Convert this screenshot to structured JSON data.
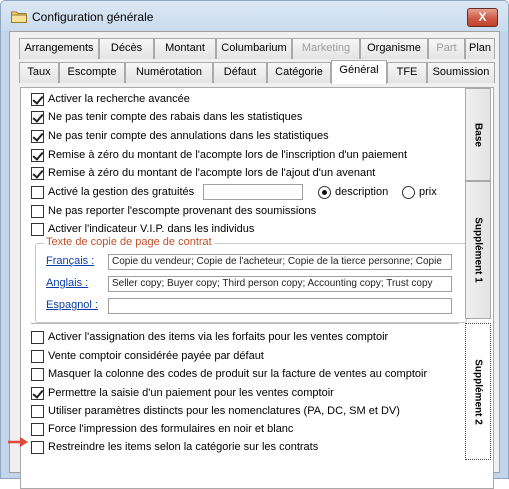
{
  "window": {
    "title": "Configuration générale",
    "close_label": "X"
  },
  "tabs_row1": [
    {
      "label": "Arrangements",
      "disabled": false
    },
    {
      "label": "Décès",
      "disabled": false
    },
    {
      "label": "Montant",
      "disabled": false
    },
    {
      "label": "Columbarium",
      "disabled": false
    },
    {
      "label": "Marketing",
      "disabled": true
    },
    {
      "label": "Organisme",
      "disabled": false
    },
    {
      "label": "Part",
      "disabled": true
    },
    {
      "label": "Plan",
      "disabled": false
    }
  ],
  "tabs_row2": [
    {
      "label": "Taux"
    },
    {
      "label": "Escompte"
    },
    {
      "label": "Numérotation"
    },
    {
      "label": "Défaut"
    },
    {
      "label": "Catégorie"
    },
    {
      "label": "Général",
      "active": true
    },
    {
      "label": "TFE"
    },
    {
      "label": "Soumission"
    }
  ],
  "side_tabs": [
    "Base",
    "Supplément 1",
    "Supplément 2"
  ],
  "options_top": [
    {
      "label": "Activer la recherche avancée",
      "checked": true
    },
    {
      "label": "Ne pas tenir compte des rabais dans les statistiques",
      "checked": true
    },
    {
      "label": "Ne pas tenir compte des annulations dans les statistiques",
      "checked": true
    },
    {
      "label": "Remise à zéro du montant de l'acompte lors de l'inscription d'un paiement",
      "checked": true
    },
    {
      "label": "Remise à zéro du montant de l'acompte lors de l'ajout d'un avenant",
      "checked": true
    },
    {
      "label": "Activé la gestion des gratuités",
      "checked": false
    },
    {
      "label": "Ne pas reporter l'escompte provenant des soumissions",
      "checked": false
    },
    {
      "label": "Activer l'indicateur V.I.P. dans les individus",
      "checked": false
    }
  ],
  "gratuites_input": "",
  "radio_options": [
    {
      "label": "description",
      "checked": true
    },
    {
      "label": "prix",
      "checked": false
    }
  ],
  "copy_group": {
    "legend": "Texte de copie de page de contrat",
    "rows": [
      {
        "label": "Français :",
        "value": "Copie du vendeur; Copie de l'acheteur; Copie de la tierce personne; Copie"
      },
      {
        "label": "Anglais :",
        "value": "Seller copy; Buyer copy; Third person copy; Accounting copy; Trust copy"
      },
      {
        "label": "Espagnol :",
        "value": ""
      }
    ]
  },
  "options_bottom": [
    {
      "label": "Activer l'assignation des items via les forfaits pour les ventes comptoir",
      "checked": false
    },
    {
      "label": "Vente comptoir considérée payée par défaut",
      "checked": false
    },
    {
      "label": "Masquer la colonne des codes de produit sur la facture de ventes au comptoir",
      "checked": false
    },
    {
      "label": "Permettre la saisie d'un paiement pour les ventes comptoir",
      "checked": true
    },
    {
      "label": "Utiliser paramètres distincts pour les nomenclatures (PA, DC, SM et DV)",
      "checked": false
    },
    {
      "label": "Force l'impression des formulaires en noir et blanc",
      "checked": false
    },
    {
      "label": "Restreindre les items selon la catégorie sur les contrats",
      "checked": false
    }
  ],
  "colors": {
    "accent_arrow": "#e0483a",
    "legend": "#c1522d",
    "link": "#0b3ea8"
  }
}
